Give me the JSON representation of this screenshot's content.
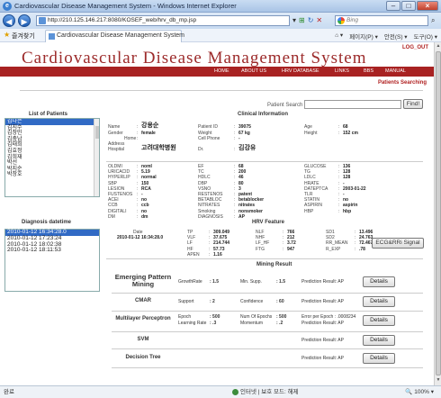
{
  "browser": {
    "window_title": "Cardiovascular Disease Management System - Windows Internet Explorer",
    "url": "http://210.125.146.217:8080/KOSEF_web/hrv_db_mp.jsp",
    "search_placeholder": "Bing",
    "favorites_label": "즐겨찾기",
    "tab_title": "Cardiovascular Disease Management System",
    "cmd_page": "페이지(P) ▾",
    "cmd_safety": "안전(S) ▾",
    "cmd_tools": "도구(O) ▾",
    "status_left": "완료",
    "status_zone": "인터넷 | 보호 모드: 해제",
    "status_zoom": "100% ▾"
  },
  "page": {
    "logout": "LOG_OUT",
    "site_title": "Cardiovascular Disease Management System",
    "nav": [
      "HOME",
      "ABOUT US",
      "HRV DATABASE",
      "LINKS",
      "BBS",
      "MANUAL"
    ],
    "patients_searching": "Patients Searching",
    "patient_search_label": "Patient Search :",
    "find_button": "Find!",
    "list_of_patients": "List of Patients",
    "clinical_information": "Clinical Information",
    "patients": [
      "김나은",
      "김지수",
      "김창민",
      "김충남",
      "김태희",
      "김효정",
      "김희재",
      "박선",
      "박지순",
      "박창호"
    ],
    "clinical": {
      "name_label": "Name",
      "name": "강용순",
      "gender_label": "Gender",
      "gender": "female",
      "home_label": "Home",
      "home": "",
      "address_label": "Address",
      "address": "",
      "hospital_label": "Hospital",
      "hospital": "고려대학병원",
      "patient_id_label": "Patient ID",
      "patient_id": "39075",
      "weight_label": "Weight",
      "weight": "67 kg",
      "cellphone_label": "Cell Phone",
      "cellphone": "-",
      "dr_label": "Dr.",
      "dr": "김강유",
      "age_label": "Age",
      "age": "68",
      "height_label": "Height",
      "height": "152 cm"
    },
    "labs_col1": [
      [
        "OLDMI",
        "noml"
      ],
      [
        "URICACID",
        "5.19"
      ],
      [
        "HYPERLIP",
        "normal"
      ],
      [
        "SBP",
        "150"
      ],
      [
        "LESION",
        "RCA"
      ],
      [
        "FUSTENOS",
        "-"
      ],
      [
        "ACEI",
        "no"
      ],
      [
        "CCB",
        "ccb"
      ],
      [
        "DIGITALI",
        "no"
      ],
      [
        "DM",
        "dm"
      ]
    ],
    "labs_col2": [
      [
        "EF",
        "68"
      ],
      [
        "TC",
        "200"
      ],
      [
        "HDLC",
        "46"
      ],
      [
        "DBP",
        "80"
      ],
      [
        "VSNO",
        "3"
      ],
      [
        "RESTENOS",
        "patent"
      ],
      [
        "BETABLOC",
        "betablocker"
      ],
      [
        "NITRATES",
        "nitrates"
      ],
      [
        "Smoking",
        "nonsmoker"
      ],
      [
        "DIAGNOSIS",
        "AP"
      ]
    ],
    "labs_col3": [
      [
        "GLUCOSE",
        "136"
      ],
      [
        "TG",
        "128"
      ],
      [
        "LDLC",
        "128"
      ],
      [
        "HRATE",
        "-"
      ],
      [
        "DATEPTCA",
        "2003-01-22"
      ],
      [
        "TLR",
        "-"
      ],
      [
        "STATIN",
        "no"
      ],
      [
        "ASPIRIN",
        "aspirin"
      ],
      [
        "HBP",
        "hbp"
      ]
    ],
    "diagnosis_datetime": "Diagnosis datetime",
    "hrv_feature": "HRV Feature",
    "diagnosis_dates": [
      "2010-01-12 16:34:28.0",
      "2010-01-12 17:23:24",
      "2010-01-12 18:02:38",
      "2010-01-12 18:11:53"
    ],
    "hrv": {
      "date_label": "Date",
      "date": "2010-01-12 16:34:28.0",
      "col1": [
        [
          "TP",
          "309.049"
        ],
        [
          "VLF",
          "37.675"
        ],
        [
          "LF",
          "214.744"
        ],
        [
          "HF",
          "57.73"
        ],
        [
          "APEN",
          "1.16"
        ]
      ],
      "col2": [
        [
          "NLF",
          "766"
        ],
        [
          "NHF",
          "212"
        ],
        [
          "LF_HF",
          "3.72"
        ],
        [
          "FTG",
          "947"
        ]
      ],
      "col3": [
        [
          "SD1",
          "13.496"
        ],
        [
          "SD2",
          "24.763"
        ],
        [
          "RR_MEAN",
          "72.467"
        ],
        [
          "R_EXP",
          ".78"
        ]
      ]
    },
    "ecg_button": "ECG&RRi Signal",
    "mining_result": "Mining Result",
    "mining": [
      {
        "name": "Emerging Pattern Mining",
        "f1": "GrowthRate",
        "v1": ": 1.5",
        "f2": "Min. Supp.",
        "v2": ": 1.5",
        "f3": "Prediction Result: AP",
        "button": "Details"
      },
      {
        "name": "CMAR",
        "f1": "Support",
        "v1": ": 2",
        "f2": "Confidence",
        "v2": ": 60",
        "f3": "Prediction Result: AP",
        "button": "Details"
      },
      {
        "name": "Multilayer Perceptron",
        "f1": "Epoch",
        "v1": ": 500",
        "f2": "Num Of Epochs",
        "v2": ": 500",
        "f3": "Error per Epoch : .0008234",
        "f1b": "Learning Rate",
        "v1b": ": .3",
        "f2b": "Momentum",
        "v2b": ": .2",
        "f3b": "Prediction Result: AP",
        "button": "Details"
      },
      {
        "name": "SVM",
        "f3": "Prediction Result: AP",
        "button": "Details"
      },
      {
        "name": "Decision Tree",
        "f3": "Prediction Result: AP",
        "button": "Details"
      }
    ]
  }
}
